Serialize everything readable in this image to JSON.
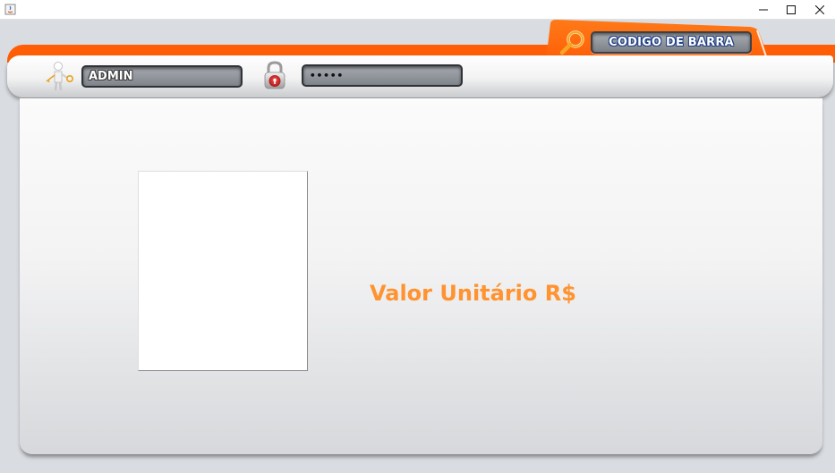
{
  "window": {
    "title": "",
    "controls": [
      "minimize",
      "maximize",
      "close"
    ]
  },
  "header": {
    "barcode_label": "CODIGO DE BARRA",
    "username_value": "ADMIN",
    "password_value": "•••••"
  },
  "main": {
    "price_label": "Valor Unitário R$"
  },
  "colors": {
    "accent_orange": "#ff5e06",
    "price_text": "#ff9330",
    "field_gray": "#8c9096"
  },
  "icons": [
    "java-app-icon",
    "search-icon",
    "user-key-icon",
    "lock-icon"
  ]
}
